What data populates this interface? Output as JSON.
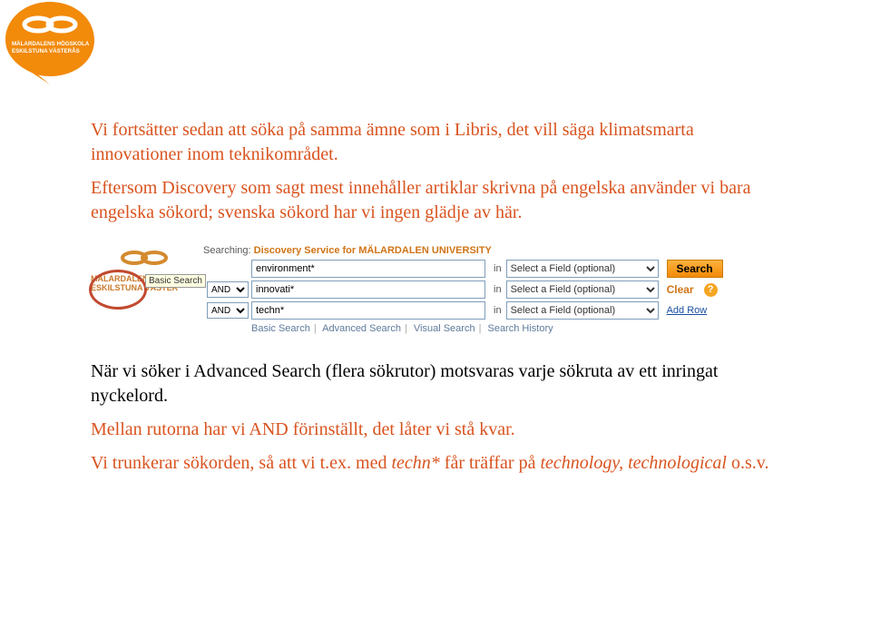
{
  "logo": {
    "line1": "MÄLARDALENS HÖGSKOLA",
    "line2": "ESKILSTUNA VÄSTERÅS"
  },
  "para1": "Vi fortsätter sedan att söka på samma ämne som i Libris, det vill säga klimatsmarta innovationer inom teknikområdet.",
  "para2": "Eftersom Discovery som sagt mest innehåller artiklar skrivna på engelska använder vi bara engelska sökord; svenska sökord har vi ingen glädje av här.",
  "para3": "När vi söker i Advanced Search (flera sökrutor) motsvaras varje sökruta av ett inringat nyckelord.",
  "para4": "Mellan rutorna har vi AND förinställt, det låter vi stå kvar.",
  "para5_a": "Vi trunkerar sökorden, så att vi t.ex. med ",
  "para5_em": "techn*",
  "para5_b": " får träffar på ",
  "para5_em2": "technology, technological",
  "para5_c": " o.s.v.",
  "search": {
    "searching_label": "Searching:",
    "service": "Discovery Service for MÄLARDALEN UNIVERSITY",
    "basic_tooltip": "Basic Search",
    "rows": [
      {
        "op": "",
        "term": "environment*",
        "in": "in",
        "field": "Select a Field (optional)"
      },
      {
        "op": "AND",
        "term": "innovati*",
        "in": "in",
        "field": "Select a Field (optional)"
      },
      {
        "op": "AND",
        "term": "techn*",
        "in": "in",
        "field": "Select a Field (optional)"
      }
    ],
    "search_btn": "Search",
    "clear": "Clear",
    "add_row": "Add Row",
    "links": [
      "Basic Search",
      "Advanced Search",
      "Visual Search",
      "Search History"
    ],
    "logo_text1": "MÄLARDALENS HÖGS",
    "logo_text2": "ESKILSTUNA VÄSTER"
  }
}
